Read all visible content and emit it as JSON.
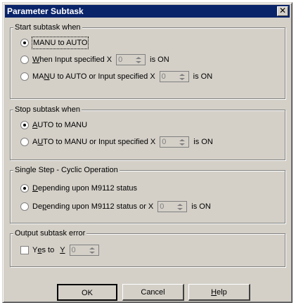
{
  "window": {
    "title": "Parameter Subtask",
    "close_glyph": "✕"
  },
  "start": {
    "legend": "Start subtask when",
    "options": [
      {
        "label": "MANU to AUTO",
        "selected": true
      },
      {
        "label_pre": "",
        "label_u": "W",
        "label_post": "hen Input specified X",
        "suffix": "is ON",
        "selected": false,
        "spin_value": "0"
      },
      {
        "label_pre": "MA",
        "label_u": "N",
        "label_post": "U to AUTO or Input specified X",
        "suffix": "is ON",
        "selected": false,
        "spin_value": "0"
      }
    ]
  },
  "stop": {
    "legend": "Stop subtask when",
    "options": [
      {
        "label_pre": "",
        "label_u": "A",
        "label_post": "UTO to MANU",
        "selected": true
      },
      {
        "label_pre": "A",
        "label_u": "U",
        "label_post": "TO to MANU or Input specified X",
        "suffix": "is ON",
        "selected": false,
        "spin_value": "0"
      }
    ]
  },
  "single_step": {
    "legend": "Single Step - Cyclic Operation",
    "options": [
      {
        "label_pre": "",
        "label_u": "D",
        "label_post": "epending upon M9112 status",
        "selected": true
      },
      {
        "label_pre": "De",
        "label_u": "p",
        "label_post": "ending upon M9112 status or X",
        "suffix": "is ON",
        "selected": false,
        "spin_value": "0"
      }
    ]
  },
  "output": {
    "legend": "Output subtask error",
    "checkbox_pre": "Y",
    "checkbox_u": "e",
    "checkbox_post": "s to",
    "device_u": "Y",
    "checked": false,
    "spin_value": "0"
  },
  "buttons": {
    "ok": "OK",
    "cancel": "Cancel",
    "help_u": "H",
    "help_post": "elp"
  }
}
